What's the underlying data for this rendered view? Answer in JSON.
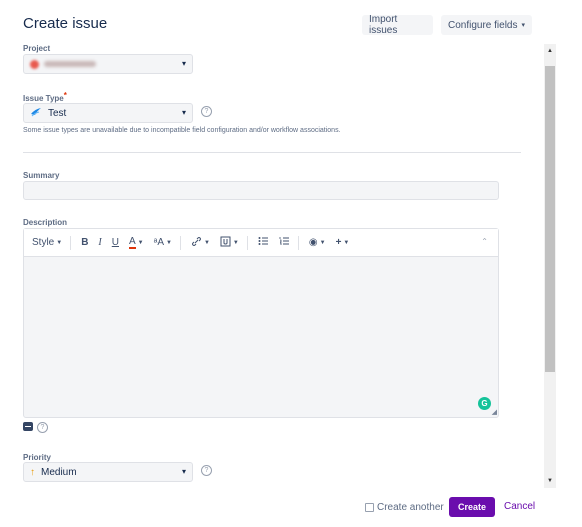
{
  "dialog": {
    "title": "Create issue",
    "import_label": "Import issues",
    "configure_label": "Configure fields",
    "chevron_icon": "chevron-down-icon"
  },
  "form": {
    "project": {
      "label": "Project",
      "value_blurred": true,
      "caret": "▾"
    },
    "issue_type": {
      "label": "Issue Type",
      "required_mark": "*",
      "value": "Test",
      "icon": "test-type-icon",
      "caret": "▾",
      "hint": "Some issue types are unavailable due to incompatible field configuration and/or workflow associations."
    },
    "summary": {
      "label": "Summary",
      "value": ""
    },
    "description": {
      "label": "Description",
      "toolbar": {
        "style": "Style",
        "bold": "B",
        "italic": "I",
        "underline": "U",
        "text_color": "A",
        "more_format": "ᵃA",
        "link": "🔗",
        "attachment": "▣",
        "bullet_list": "☰",
        "numbered_list": "≔",
        "emoticon": "◉",
        "insert_more": "+",
        "collapse": "⌃"
      },
      "value": ""
    },
    "priority": {
      "label": "Priority",
      "value": "Medium",
      "icon": "arrow-up-icon",
      "caret": "▾"
    }
  },
  "help_glyph": "?",
  "footer": {
    "create_another_label": "Create another",
    "create_another_checked": false,
    "create_label": "Create",
    "cancel_label": "Cancel"
  },
  "colors": {
    "primary": "#6a0dad",
    "priority_medium": "#e89b0c",
    "test_type_icon": "#1e88e5",
    "grammarly": "#15c39a"
  }
}
